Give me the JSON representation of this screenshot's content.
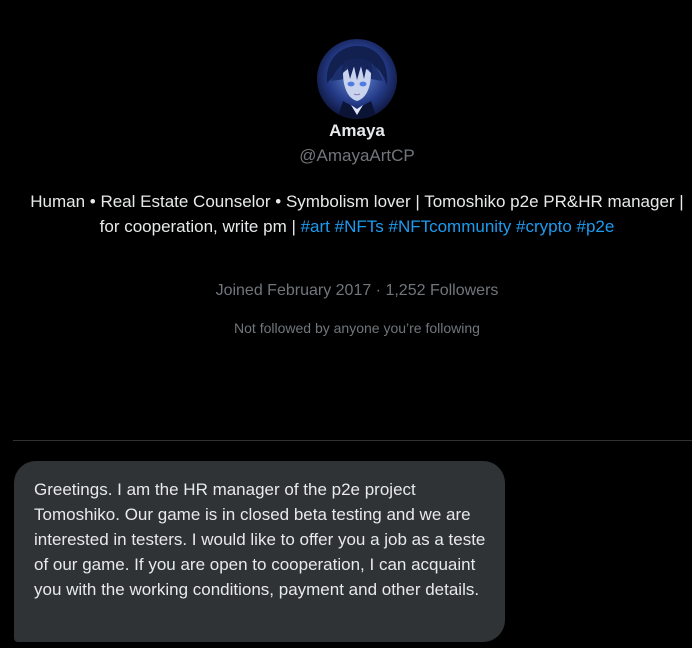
{
  "profile": {
    "display_name": "Amaya",
    "handle": "@AmayaArtCP",
    "bio": {
      "text": "Human • Real Estate Counselor • Symbolism lover | Tomoshiko p2e PR&HR manager | for cooperation, write pm | ",
      "hashtags": [
        {
          "label": "#art",
          "trailing": " "
        },
        {
          "label": "#NFTs",
          "trailing": " "
        },
        {
          "label": "#NFTcommunity",
          "trailing": " "
        },
        {
          "label": "#crypto",
          "trailing": " "
        },
        {
          "label": "#p2e",
          "trailing": ""
        }
      ]
    },
    "joined": "Joined February 2017",
    "separator": " · ",
    "followers": "1,252 Followers",
    "not_followed": "Not followed by anyone you’re following"
  },
  "message": {
    "text": "Greetings. I am the HR manager of the p2e project Tomoshiko. Our game is in closed beta testing and we are interested in testers. I would like to offer you a job as a teste of our game. If you are open to cooperation, I can acquaint you with the working conditions, payment and other details."
  },
  "colors": {
    "background": "#000000",
    "text_primary": "#e7e9ea",
    "text_secondary": "#71767b",
    "link": "#1d9bf0",
    "bubble": "#2f3336",
    "divider": "#2f3336"
  },
  "icons": {
    "avatar": "avatar-anime-portrait"
  }
}
